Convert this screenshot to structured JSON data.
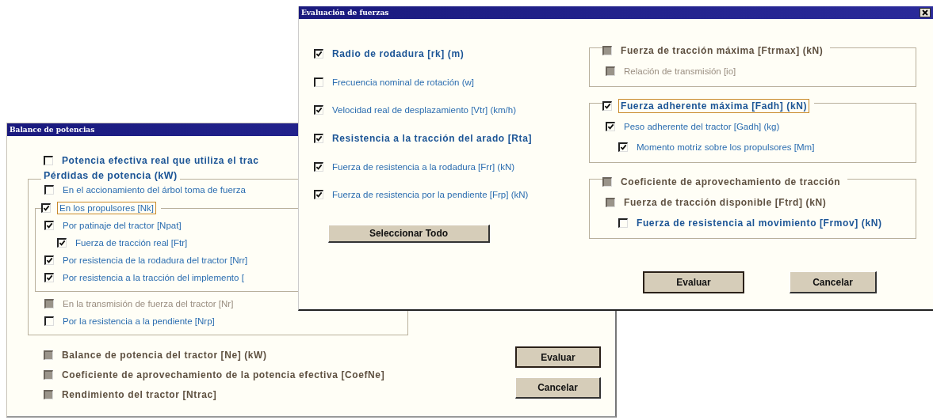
{
  "balance_window": {
    "title": "Balance de potencias",
    "items": [
      {
        "kind": "checkbox",
        "label": "Potencia efectiva real que utiliza el trac",
        "checked": false,
        "disabled": false,
        "bold": true
      },
      {
        "kind": "group",
        "title": "Pérdidas de potencia (kW)",
        "children": [
          {
            "kind": "checkbox",
            "label": "En el accionamiento del árbol  toma de fuerza",
            "checked": false,
            "disabled": false,
            "bold": false
          },
          {
            "kind": "group",
            "legend": {
              "label": "En los propulsores  [Nk]",
              "checked": true,
              "disabled": false,
              "bold": false,
              "focused": true
            },
            "children": [
              {
                "kind": "checkbox",
                "label": "Por patinaje del tractor [Npat]",
                "checked": true,
                "disabled": false,
                "bold": false,
                "children": [
                  {
                    "kind": "checkbox",
                    "label": "Fuerza de tracción real [Ftr]",
                    "checked": true,
                    "disabled": false,
                    "bold": false
                  }
                ]
              },
              {
                "kind": "checkbox",
                "label": "Por resistencia de la rodadura del tractor [Nrr]",
                "checked": true,
                "disabled": false,
                "bold": false
              },
              {
                "kind": "checkbox",
                "label": "Por resistencia a la tracción del implemento [",
                "checked": true,
                "disabled": false,
                "bold": false
              }
            ]
          },
          {
            "kind": "checkbox",
            "label": "En la transmisión de fuerza del tractor [Nr]",
            "checked": false,
            "disabled": true,
            "bold": false
          },
          {
            "kind": "checkbox",
            "label": "Por la resistencia a la pendiente [Nrp]",
            "checked": false,
            "disabled": false,
            "bold": false
          }
        ]
      },
      {
        "kind": "checkbox",
        "label": "Balance de potencia del tractor [Ne] (kW)",
        "checked": false,
        "disabled": true,
        "bold": true
      },
      {
        "kind": "checkbox",
        "label": "Coeficiente de aprovechamiento de  la potencia efectiva [CoefNe]",
        "checked": false,
        "disabled": true,
        "bold": true
      },
      {
        "kind": "checkbox",
        "label": "Rendimiento del tractor [Ntrac]",
        "checked": false,
        "disabled": true,
        "bold": true
      }
    ],
    "buttons": [
      {
        "label": "Evaluar",
        "default": true
      },
      {
        "label": "Cancelar",
        "default": false
      }
    ]
  },
  "fuerzas_window": {
    "title": "Evaluación de fuerzas",
    "left_items": [
      {
        "kind": "checkbox",
        "label": "Radio de rodadura [rk] (m)",
        "checked": true,
        "disabled": false,
        "bold": true
      },
      {
        "kind": "checkbox",
        "label": "Frecuencia nominal de rotación (w]",
        "checked": false,
        "disabled": false,
        "bold": false
      },
      {
        "kind": "checkbox",
        "label": "Velocidad real de desplazamiento [Vtr]  (km/h)",
        "checked": true,
        "disabled": false,
        "bold": false
      },
      {
        "kind": "checkbox",
        "label": "Resistencia a la tracción del arado [Rta]",
        "checked": true,
        "disabled": false,
        "bold": true
      },
      {
        "kind": "checkbox",
        "label": "Fuerza de resistencia a la rodadura [Frr] (kN)",
        "checked": true,
        "disabled": false,
        "bold": false
      },
      {
        "kind": "checkbox",
        "label": "Fuerza de resistencia por la pendiente [Frp] (kN)",
        "checked": true,
        "disabled": false,
        "bold": false
      }
    ],
    "select_all": "Seleccionar Todo",
    "right_items": [
      {
        "kind": "group",
        "legend": {
          "label": "Fuerza de tracción máxima [Ftrmax] (kN)",
          "checked": false,
          "disabled": true,
          "bold": true,
          "focused": false
        },
        "children": [
          {
            "kind": "checkbox",
            "label": "Relación de transmisión [io]",
            "checked": false,
            "disabled": true,
            "bold": false
          }
        ]
      },
      {
        "kind": "group",
        "legend": {
          "label": "Fuerza adherente máxima [Fadh] (kN)",
          "checked": true,
          "disabled": false,
          "bold": true,
          "focused": true
        },
        "children": [
          {
            "kind": "checkbox",
            "label": "Peso adherente del tractor [Gadh] (kg)",
            "checked": true,
            "disabled": false,
            "bold": false,
            "children": [
              {
                "kind": "checkbox",
                "label": "Momento motriz sobre los propulsores [Mm]",
                "checked": true,
                "disabled": false,
                "bold": false
              }
            ]
          }
        ]
      },
      {
        "kind": "group",
        "legend": {
          "label": "Coeficiente de aprovechamiento de tracción",
          "checked": false,
          "disabled": true,
          "bold": true,
          "focused": false
        },
        "children": [
          {
            "kind": "checkbox",
            "label": "Fuerza de tracción disponible [Ftrd] (kN)",
            "checked": false,
            "disabled": true,
            "bold": true,
            "children": [
              {
                "kind": "checkbox",
                "label": "Fuerza de resistencia al movimiento [Frmov] (kN)",
                "checked": false,
                "disabled": false,
                "bold": true
              }
            ]
          }
        ]
      }
    ],
    "buttons": [
      {
        "label": "Evaluar",
        "default": true
      },
      {
        "label": "Cancelar",
        "default": false
      }
    ]
  }
}
